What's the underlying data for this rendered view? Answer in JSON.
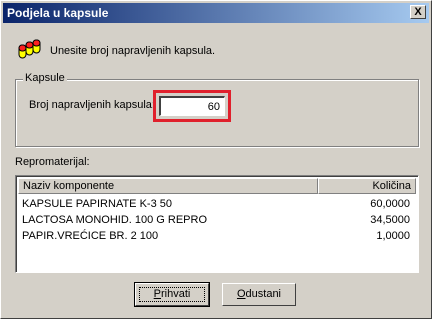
{
  "window": {
    "title": "Podjela u kapsule",
    "close_glyph": "X"
  },
  "intro": {
    "icon": "capsules-icon",
    "text": "Unesite broj napravljenih kapsula."
  },
  "group": {
    "title": "Kapsule",
    "field_label": "Broj napravljenih kapsula:",
    "field_value": "60",
    "highlight_color": "#e0202c"
  },
  "materials": {
    "label": "Repromaterijal:",
    "columns": [
      "Naziv komponente",
      "Količina"
    ],
    "rows": [
      {
        "name": "KAPSULE PAPIRNATE K-3 50",
        "qty": "60,0000"
      },
      {
        "name": "LACTOSA MONOHID. 100 G REPRO",
        "qty": "34,5000"
      },
      {
        "name": "PAPIR.VREĆICE BR. 2 100",
        "qty": "1,0000"
      }
    ]
  },
  "buttons": {
    "ok_first": "P",
    "ok_rest": "rihvati",
    "cancel_first": "O",
    "cancel_rest": "dustani"
  },
  "colors": {
    "title_bar_start": "#0a246a",
    "title_bar_end": "#a6caf0",
    "window_bg": "#d4d0c8"
  }
}
